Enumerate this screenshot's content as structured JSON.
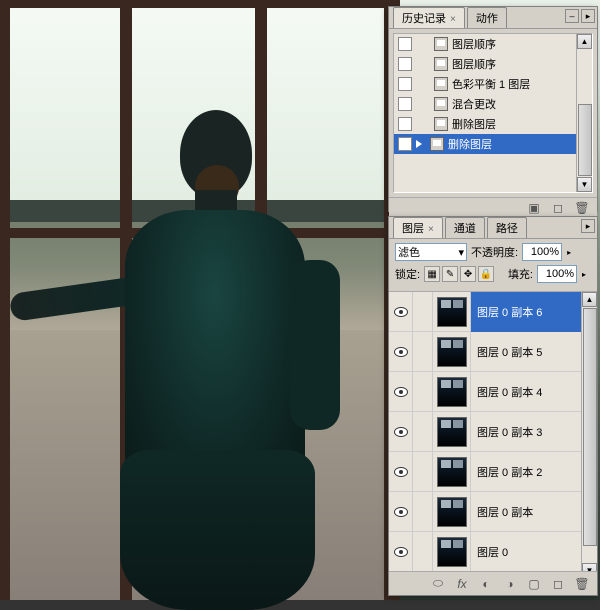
{
  "history": {
    "tab_active": "历史记录",
    "tab_inactive": "动作",
    "items": [
      {
        "label": "图层顺序"
      },
      {
        "label": "图层顺序"
      },
      {
        "label": "色彩平衡 1 图层"
      },
      {
        "label": "混合更改"
      },
      {
        "label": "删除图层"
      },
      {
        "label": "删除图层",
        "selected": true
      }
    ]
  },
  "layers": {
    "tab_active": "图层",
    "tab2": "通道",
    "tab3": "路径",
    "blend_mode": "滤色",
    "opacity_label": "不透明度:",
    "opacity_value": "100%",
    "lock_label": "锁定:",
    "fill_label": "填充:",
    "fill_value": "100%",
    "items": [
      {
        "name": "图层 0 副本 6",
        "selected": true
      },
      {
        "name": "图层 0 副本 5"
      },
      {
        "name": "图层 0 副本 4"
      },
      {
        "name": "图层 0 副本 3"
      },
      {
        "name": "图层 0 副本 2"
      },
      {
        "name": "图层 0 副本"
      },
      {
        "name": "图层 0"
      }
    ],
    "footer_fx": "fx"
  }
}
